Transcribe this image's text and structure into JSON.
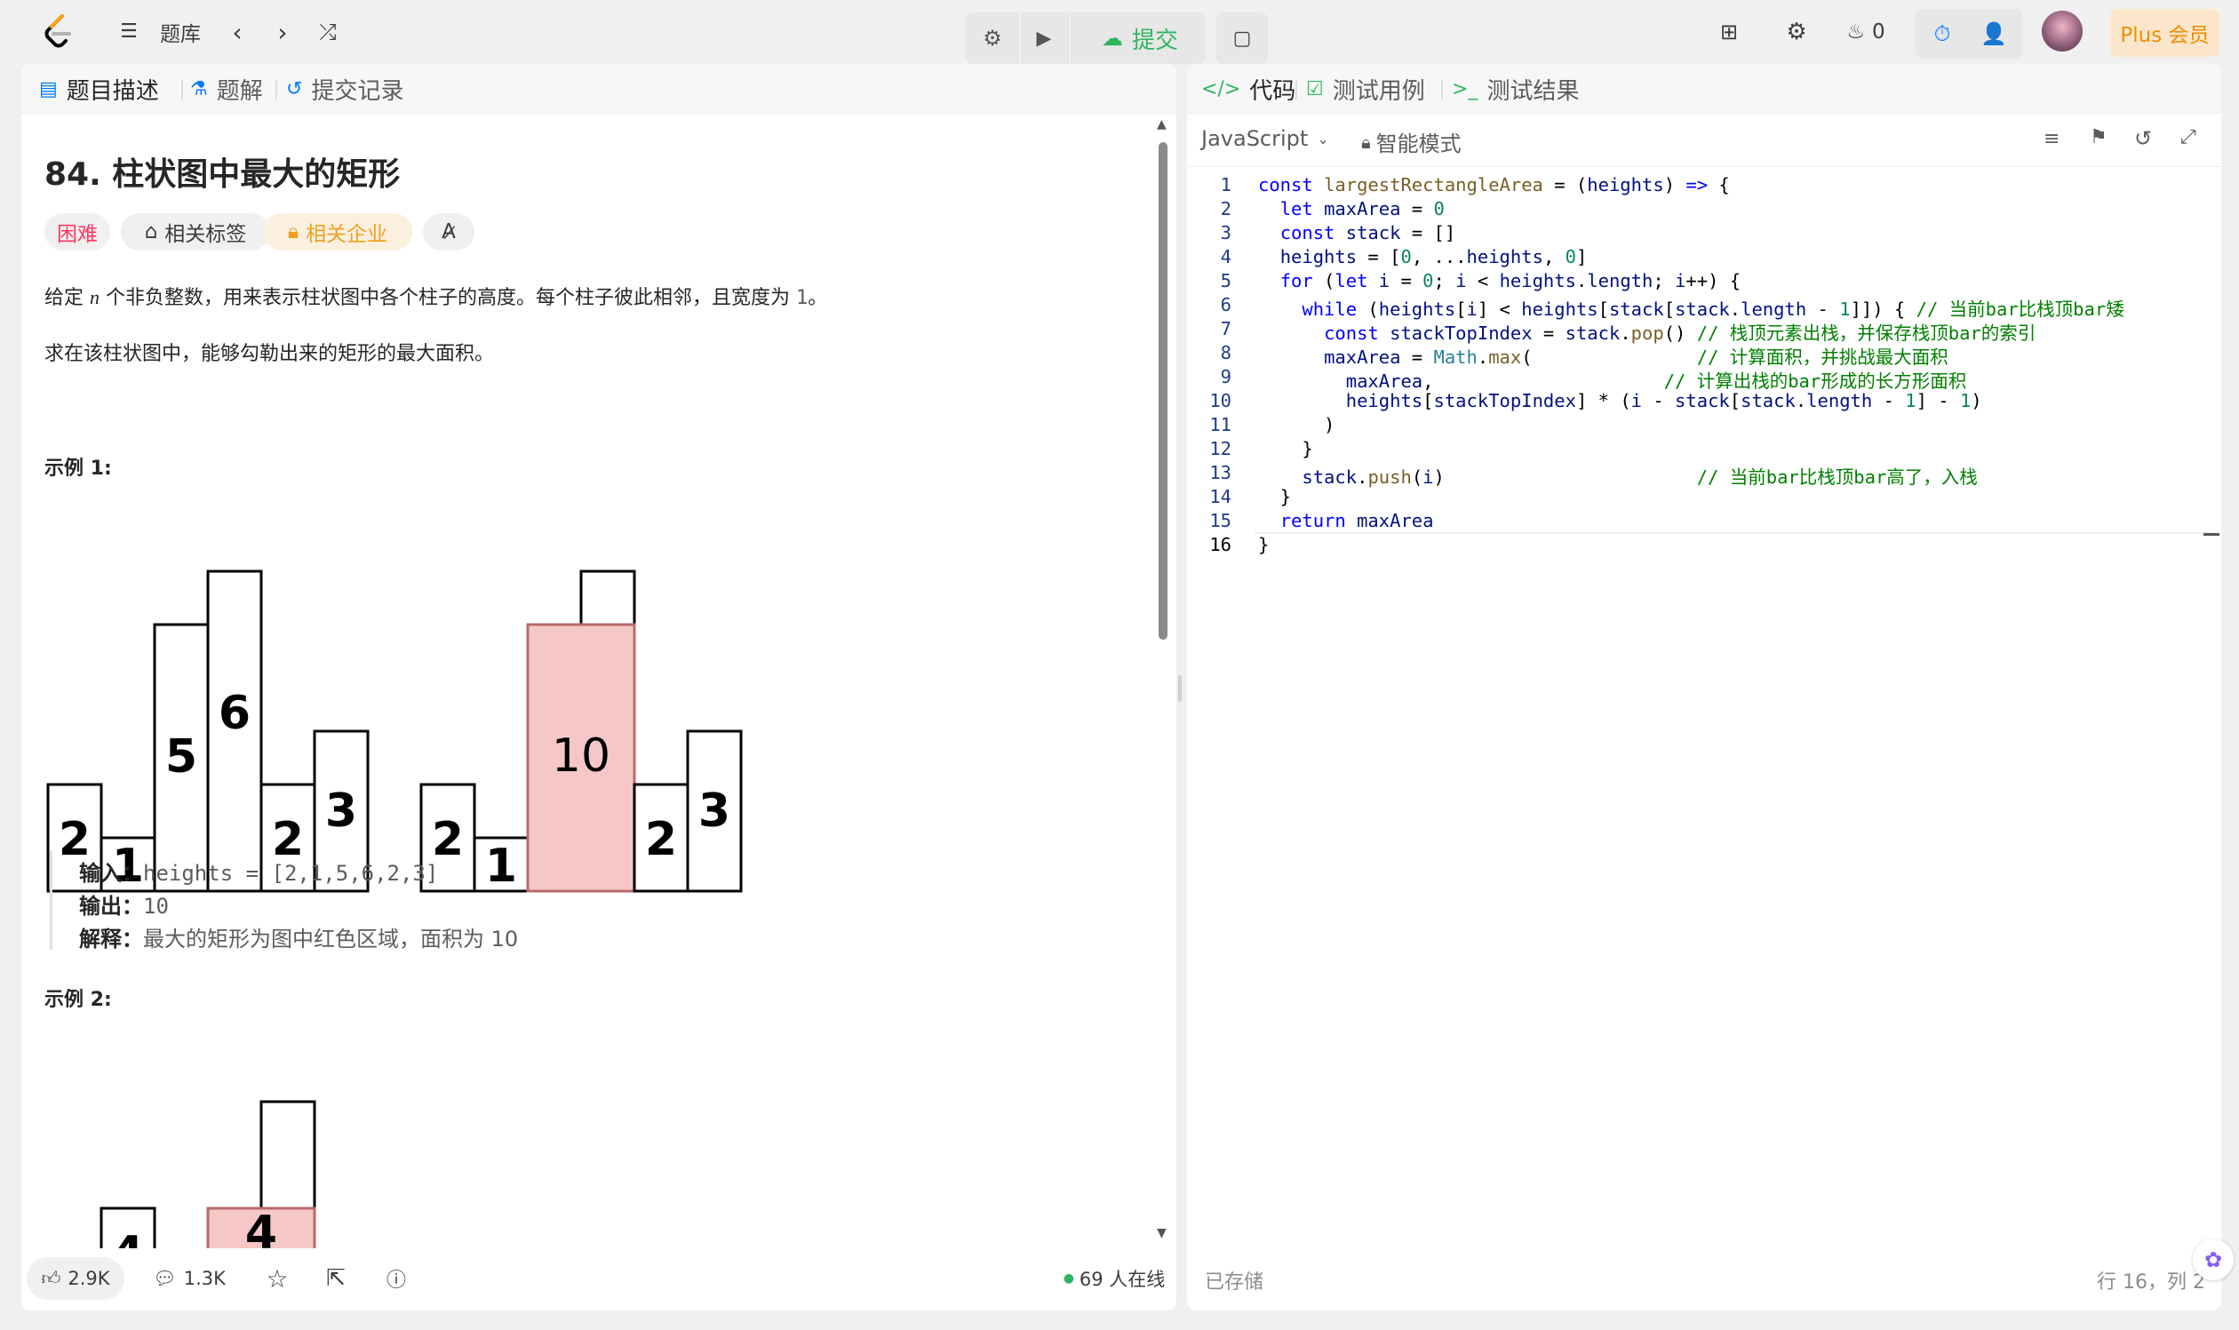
{
  "topbar": {
    "problem_bank": "题库",
    "submit": "提交",
    "flame_count": "0",
    "plus": "Plus 会员"
  },
  "left": {
    "tabs": [
      "题目描述",
      "题解",
      "提交记录"
    ],
    "title": "84. 柱状图中最大的矩形",
    "chips": {
      "difficulty": "困难",
      "tags": "相关标签",
      "companies": "相关企业"
    },
    "desc1_a": "给定",
    "desc1_n": "n",
    "desc1_b": "个非负整数，用来表示柱状图中各个柱子的高度。每个柱子彼此相邻，且宽度为",
    "desc1_one": "1",
    "desc1_end": "。",
    "desc2": "求在该柱状图中，能够勾勒出来的矩形的最大面积。",
    "example1": {
      "title": "示例 1:",
      "input_label": "输入：",
      "input": "heights = [2,1,5,6,2,3]",
      "output_label": "输出：",
      "output": "10",
      "explain_label": "解释：",
      "explain": "最大的矩形为图中红色区域，面积为 10"
    },
    "example2": {
      "title": "示例 2:"
    },
    "bottom": {
      "likes": "2.9K",
      "comments": "1.3K",
      "online": "69 人在线"
    }
  },
  "right": {
    "tabs": [
      "代码",
      "测试用例",
      "测试结果"
    ],
    "language": "JavaScript",
    "mode": "智能模式",
    "saved": "已存储",
    "cursor": "行 16，列 2"
  },
  "colors": {
    "accent": "#2db55d",
    "plus": "#f08c00",
    "hard": "#ff375f",
    "highlight": "#f5c7c7",
    "keyword": "#0000ff",
    "comment": "#008000"
  }
}
